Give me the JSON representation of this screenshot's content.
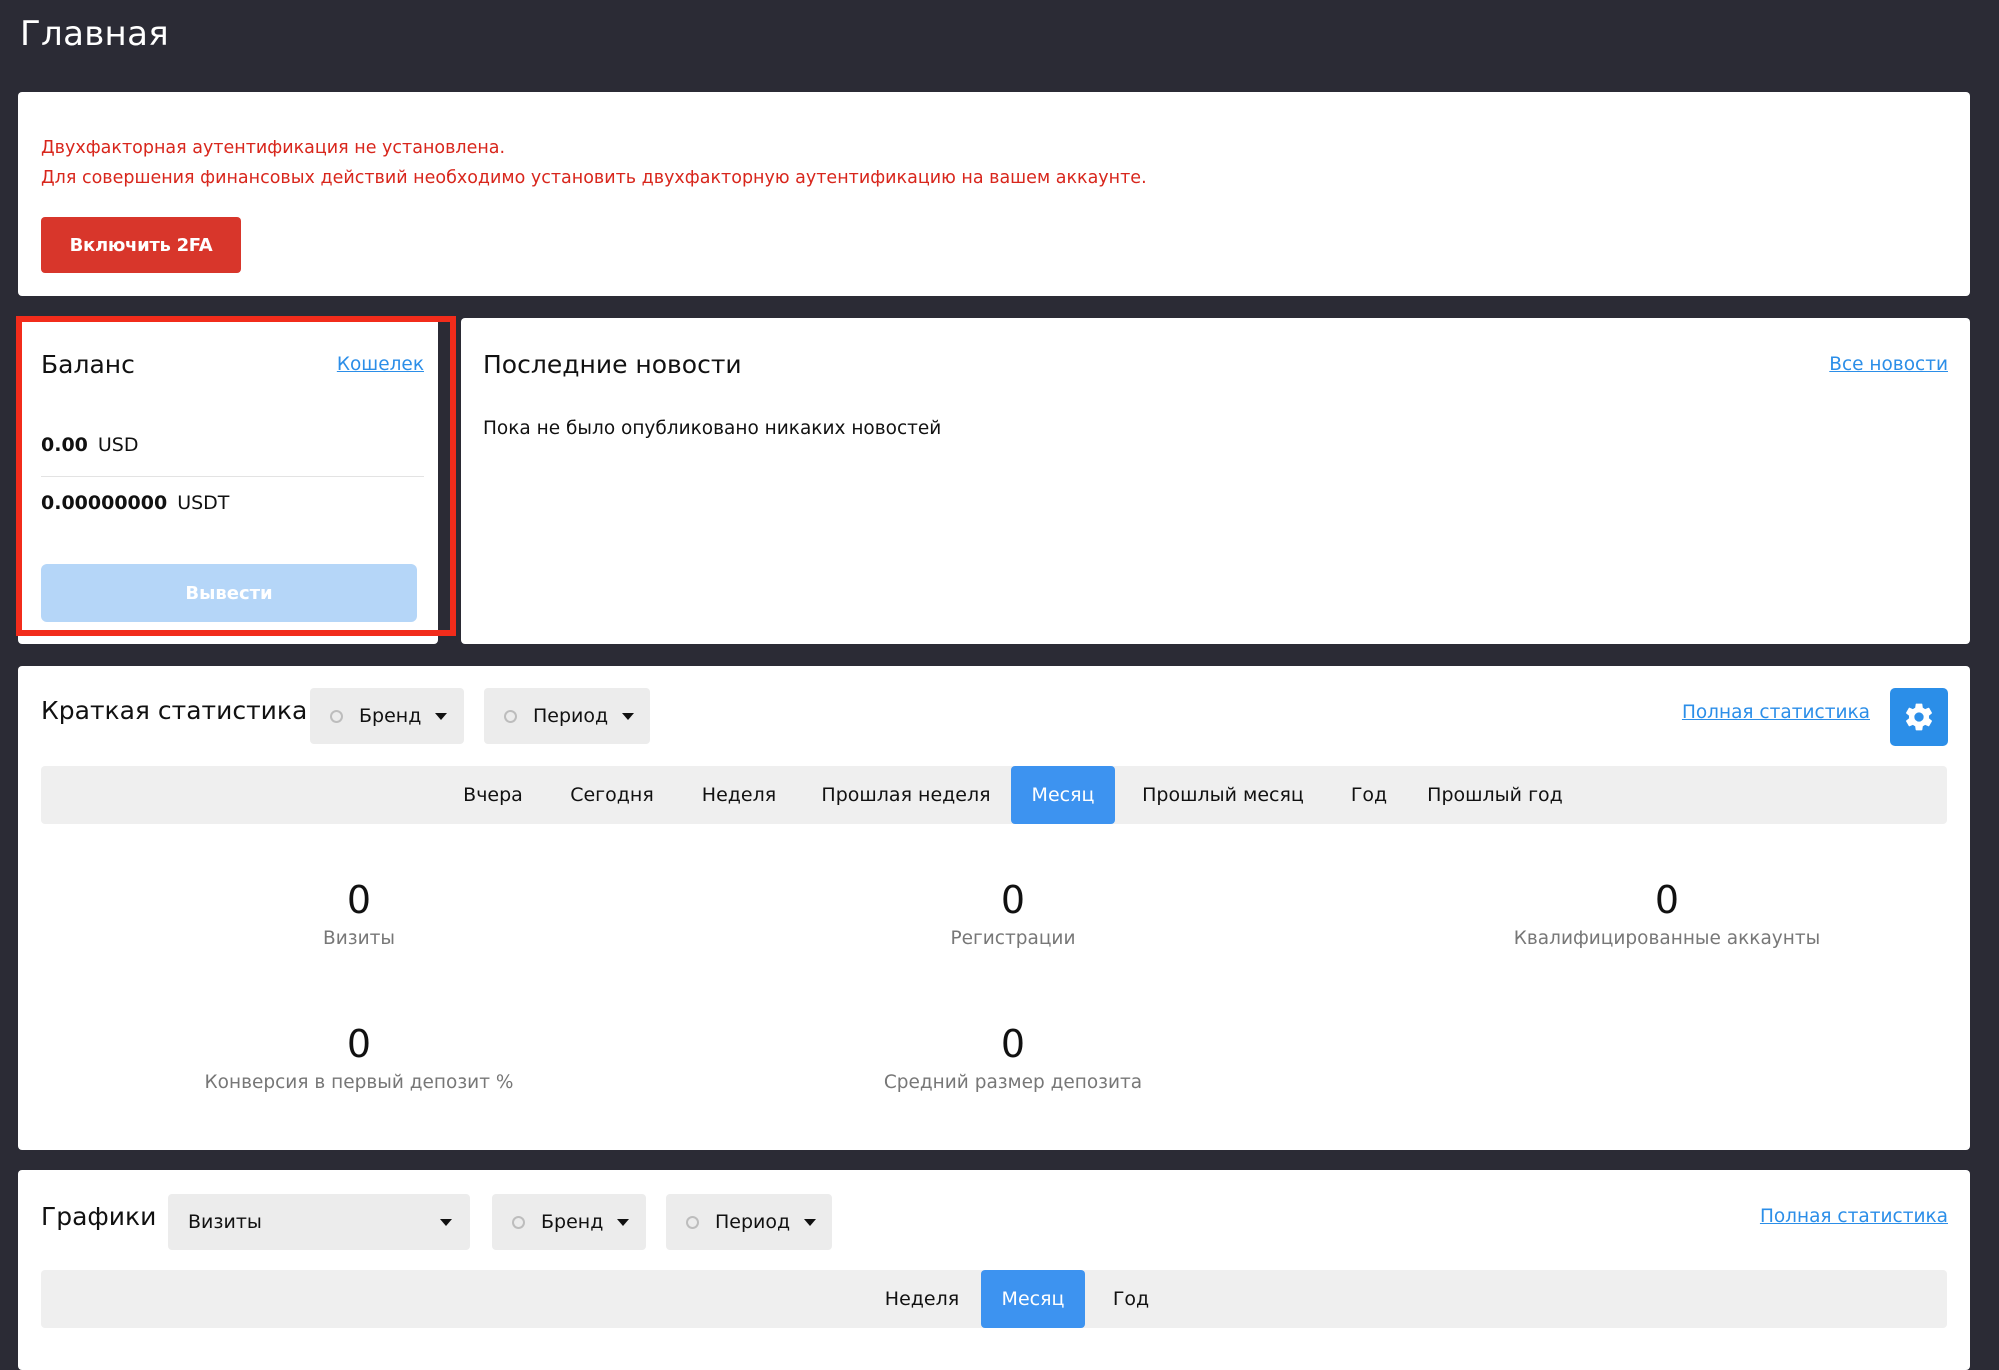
{
  "page": {
    "title": "Главная"
  },
  "twofa": {
    "warning_line1": "Двухфакторная аутентификация не установлена.",
    "warning_line2": "Для совершения финансовых действий необходимо установить двухфакторную аутентификацию на вашем аккаунте.",
    "button_label": "Включить 2FA"
  },
  "balance": {
    "title": "Баланс",
    "wallet_link": "Кошелек",
    "rows": [
      {
        "amount": "0.00",
        "currency": "USD"
      },
      {
        "amount": "0.00000000",
        "currency": "USDT"
      }
    ],
    "withdraw_label": "Вывести"
  },
  "news": {
    "title": "Последние новости",
    "all_link": "Все новости",
    "empty_text": "Пока не было опубликовано никаких новостей"
  },
  "stats": {
    "title": "Краткая статистика",
    "brand_filter": "Бренд",
    "period_filter": "Период",
    "full_link": "Полная статистика",
    "settings_icon": "gear-icon",
    "tabs": [
      {
        "label": "Вчера",
        "active": false
      },
      {
        "label": "Сегодня",
        "active": false
      },
      {
        "label": "Неделя",
        "active": false
      },
      {
        "label": "Прошлая неделя",
        "active": false
      },
      {
        "label": "Месяц",
        "active": true
      },
      {
        "label": "Прошлый месяц",
        "active": false
      },
      {
        "label": "Год",
        "active": false
      },
      {
        "label": "Прошлый год",
        "active": false
      }
    ],
    "metrics": [
      {
        "value": "0",
        "label": "Визиты"
      },
      {
        "value": "0",
        "label": "Регистрации"
      },
      {
        "value": "0",
        "label": "Квалифицированные аккаунты"
      },
      {
        "value": "0",
        "label": "Конверсия в первый депозит %"
      },
      {
        "value": "0",
        "label": "Средний размер депозита"
      }
    ]
  },
  "charts": {
    "title": "Графики",
    "metric_select": "Визиты",
    "brand_filter": "Бренд",
    "period_filter": "Период",
    "full_link": "Полная статистика",
    "tabs": [
      {
        "label": "Неделя",
        "active": false
      },
      {
        "label": "Месяц",
        "active": true
      },
      {
        "label": "Год",
        "active": false
      }
    ]
  },
  "colors": {
    "background": "#2b2b35",
    "danger": "#d8362b",
    "accent": "#3d93f0",
    "link": "#2b8ee8",
    "highlight": "#f22c1b"
  }
}
